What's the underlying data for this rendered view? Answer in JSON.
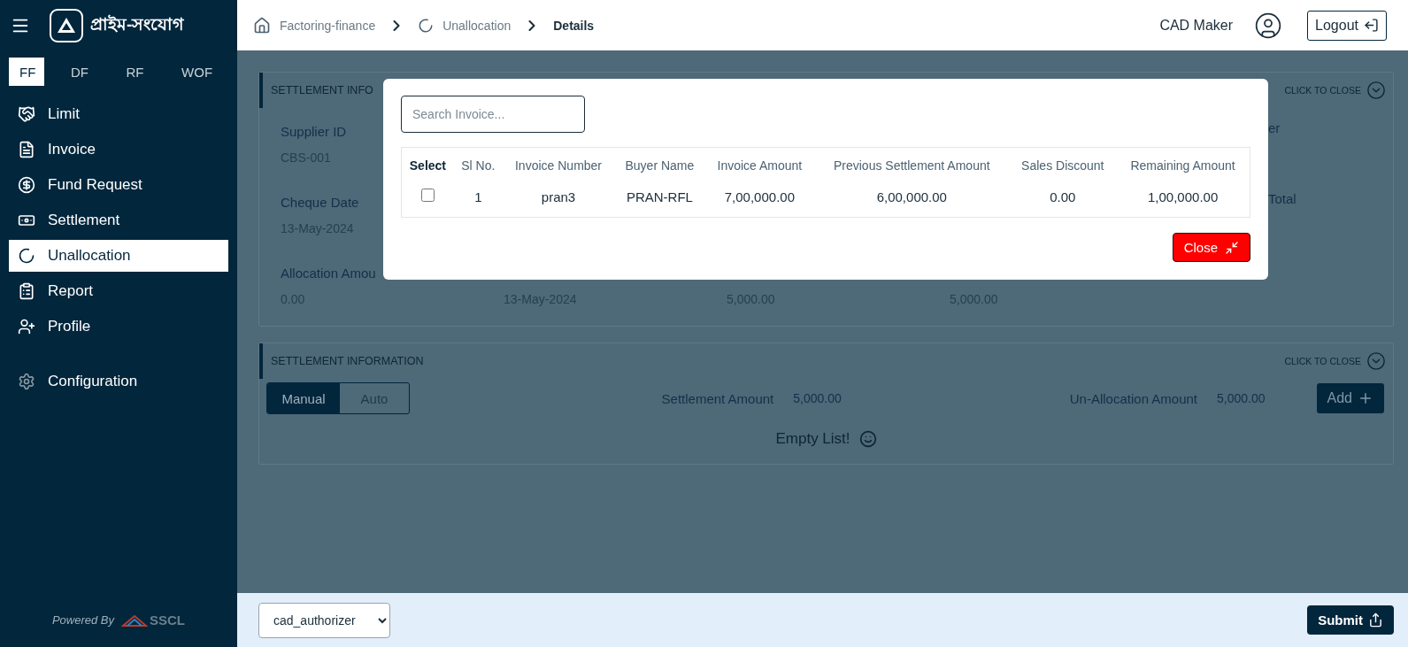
{
  "sidebar": {
    "brand": "প্রাইম-সংযোগ",
    "finance_tabs": [
      {
        "label": "FF",
        "selected": true
      },
      {
        "label": "DF",
        "selected": false
      },
      {
        "label": "RF",
        "selected": false
      },
      {
        "label": "WOF",
        "selected": false
      }
    ],
    "nav": [
      {
        "label": "Limit",
        "selected": false
      },
      {
        "label": "Invoice",
        "selected": false
      },
      {
        "label": "Fund Request",
        "selected": false
      },
      {
        "label": "Settlement",
        "selected": false
      },
      {
        "label": "Unallocation",
        "selected": true
      },
      {
        "label": "Report",
        "selected": false
      },
      {
        "label": "Profile",
        "selected": false
      }
    ],
    "configuration": {
      "label": "Configuration",
      "selected": false
    },
    "footer": {
      "powered_by": "Powered By",
      "logo_text": "SSCL"
    }
  },
  "header": {
    "breadcrumbs": [
      {
        "label": "Factoring-finance",
        "current": false
      },
      {
        "label": "Unallocation",
        "current": false
      },
      {
        "label": "Details",
        "current": true
      }
    ],
    "user": "CAD Maker",
    "logout": "Logout"
  },
  "settlement_card": {
    "title": "SETTLEMENT INFO",
    "toggle": "CLICK TO CLOSE",
    "rows": [
      [
        {
          "label": "Supplier ID",
          "value": "CBS-001"
        },
        {},
        {},
        {},
        {
          "label": "er"
        }
      ],
      [
        {
          "label": "Cheque Date",
          "value": "13-May-2024"
        },
        {},
        {},
        {},
        {
          "label": "Total"
        }
      ],
      [
        {
          "label": "Allocation Amou",
          "value": "0.00"
        },
        {
          "value": "13-May-2024"
        },
        {
          "value": "5,000.00"
        },
        {
          "value": "5,000.00"
        },
        {}
      ]
    ]
  },
  "settlement_info": {
    "title": "SETTLEMENT INFORMATION",
    "toggle": "CLICK TO CLOSE",
    "modes": [
      {
        "label": "Manual",
        "selected": true
      },
      {
        "label": "Auto",
        "selected": false
      }
    ],
    "settlement_amount": {
      "label": "Settlement Amount",
      "value": "5,000.00"
    },
    "unallocation_amount": {
      "label": "Un-Allocation Amount",
      "value": "5,000.00"
    },
    "add": "Add",
    "empty": "Empty List!"
  },
  "modal": {
    "search": {
      "placeholder": "Search Invoice..."
    },
    "columns": [
      "Select",
      "Sl No.",
      "Invoice Number",
      "Buyer Name",
      "Invoice Amount",
      "Previous Settlement Amount",
      "Sales Discount",
      "Remaining Amount"
    ],
    "rows": [
      {
        "checked": false,
        "cells": [
          "",
          "1",
          "pran3",
          "PRAN-RFL",
          "7,00,000.00",
          "6,00,000.00",
          "0.00",
          "1,00,000.00"
        ]
      }
    ],
    "close": "Close"
  },
  "footer": {
    "role": "cad_authorizer",
    "submit": "Submit"
  }
}
